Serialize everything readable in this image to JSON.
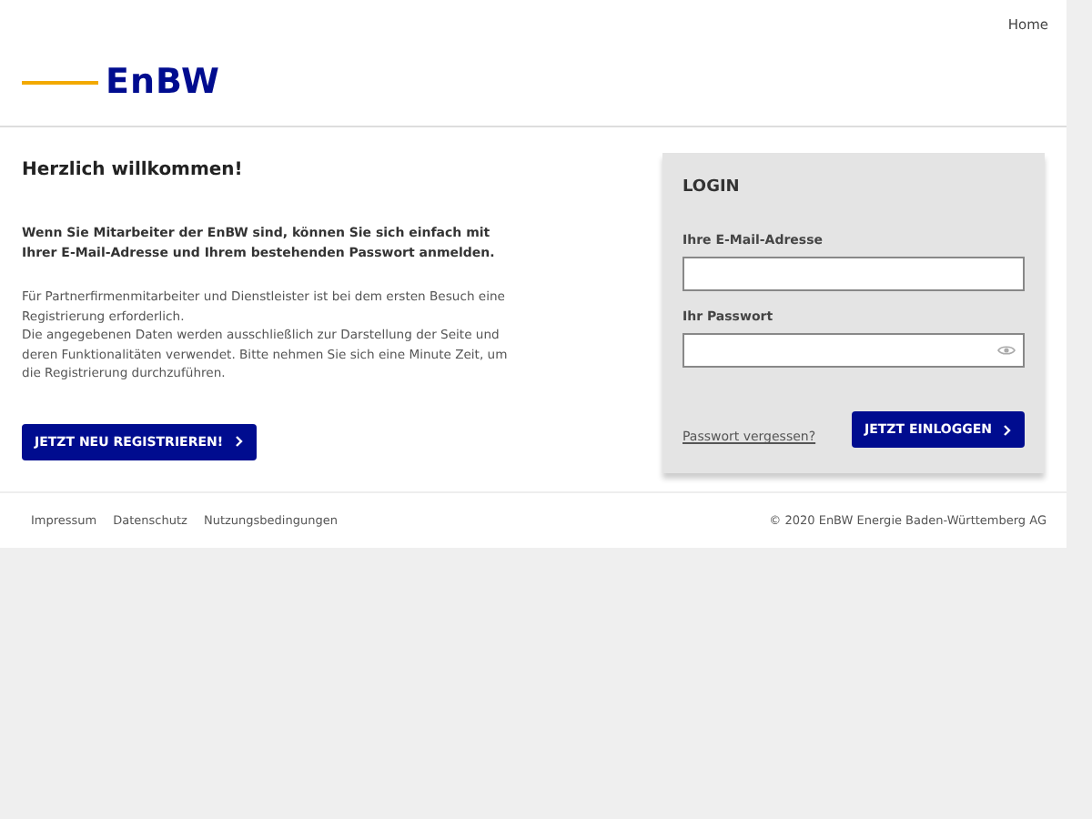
{
  "nav": {
    "home": "Home"
  },
  "logo": {
    "text": "EnBW"
  },
  "welcome": {
    "title": "Herzlich willkommen!",
    "lead": "Wenn Sie Mitarbeiter der EnBW sind, können Sie sich einfach mit Ihrer E-Mail-Adresse und Ihrem bestehenden Passwort anmelden.",
    "paragraphs": [
      "Für Partnerfirmenmitarbeiter und Dienstleister ist bei dem ersten Besuch eine Registrierung erforderlich.",
      "Die angegebenen Daten werden ausschließlich zur Darstellung der Seite und deren Funktionalitäten verwendet. Bitte nehmen Sie sich eine Minute Zeit, um die Registrierung durchzuführen."
    ],
    "register_button": "JETZT NEU REGISTRIEREN!"
  },
  "login": {
    "title": "LOGIN",
    "email_label": "Ihre E-Mail-Adresse",
    "password_label": "Ihr Passwort",
    "forgot_link": "Passwort vergessen?",
    "submit_button": "JETZT EINLOGGEN"
  },
  "footer": {
    "links": [
      "Impressum",
      "Datenschutz",
      "Nutzungsbedingungen"
    ],
    "copyright": "© 2020 EnBW Energie Baden-Württemberg AG"
  }
}
